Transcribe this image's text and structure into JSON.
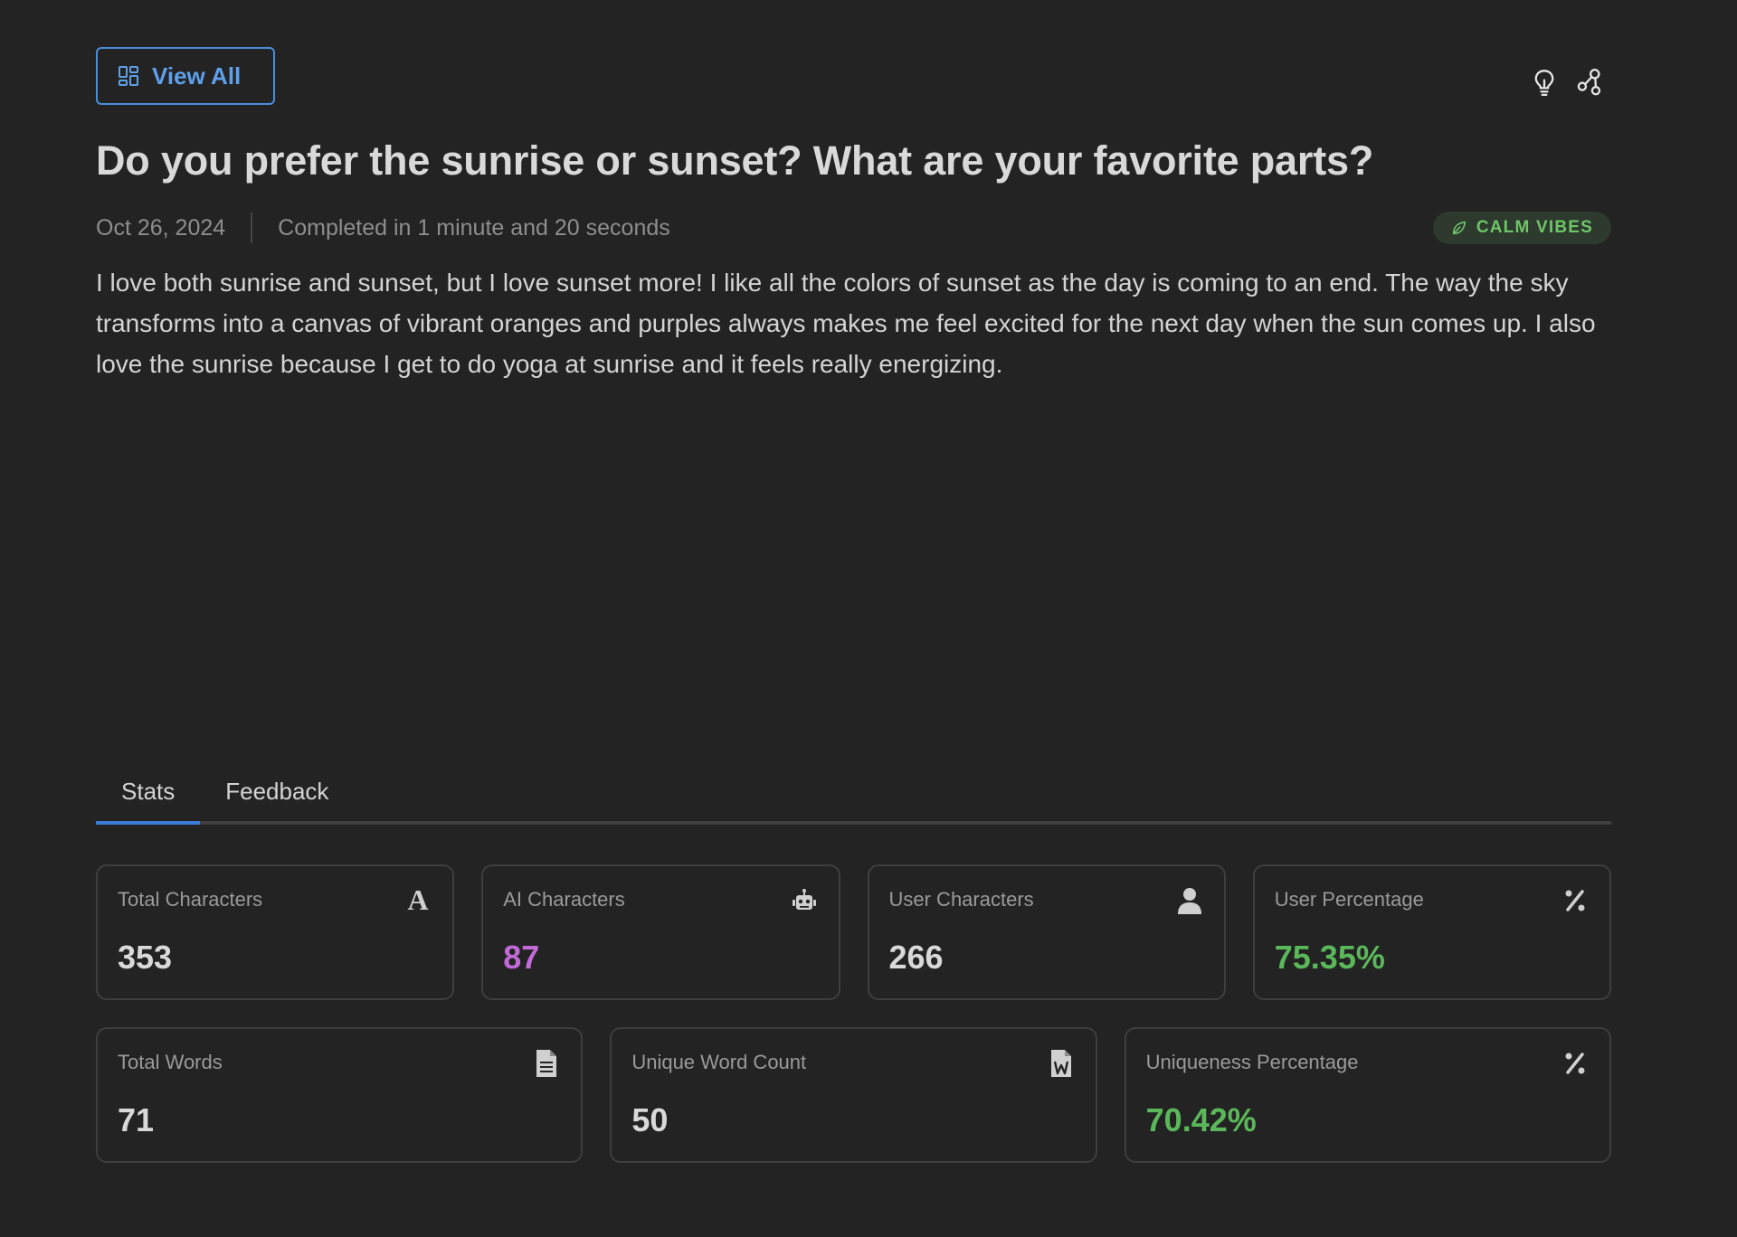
{
  "header": {
    "view_all_label": "View All",
    "icons": [
      "lightbulb-icon",
      "share-icon"
    ]
  },
  "entry": {
    "title": "Do you prefer the sunrise or sunset? What are your favorite parts?",
    "date": "Oct 26, 2024",
    "completed": "Completed in 1 minute and 20 seconds",
    "badge": "CALM VIBES",
    "body": "I love both sunrise and sunset, but I love sunset more! I like all the colors of sunset as the day is coming to an end. The way the sky transforms into a canvas of vibrant oranges and purples always makes me feel excited for the next day when the sun comes up. I also love the sunrise because I get to do yoga at sunrise and it feels really energizing."
  },
  "tabs": [
    {
      "label": "Stats",
      "active": true
    },
    {
      "label": "Feedback",
      "active": false
    }
  ],
  "stats": {
    "row1": [
      {
        "label": "Total Characters",
        "value": "353",
        "icon": "letter-a-icon"
      },
      {
        "label": "AI Characters",
        "value": "87",
        "icon": "robot-icon"
      },
      {
        "label": "User Characters",
        "value": "266",
        "icon": "user-icon"
      },
      {
        "label": "User Percentage",
        "value": "75.35%",
        "icon": "percent-icon"
      }
    ],
    "row2": [
      {
        "label": "Total Words",
        "value": "71",
        "icon": "document-icon"
      },
      {
        "label": "Unique Word Count",
        "value": "50",
        "icon": "word-file-icon"
      },
      {
        "label": "Uniqueness Percentage",
        "value": "70.42%",
        "icon": "percent-icon"
      }
    ]
  },
  "colors": {
    "background": "#232323",
    "accent": "#4a8fdc",
    "badge_green": "#6fc46a",
    "ai_purple": "#c26ad8",
    "percent_green": "#5bb85a"
  }
}
